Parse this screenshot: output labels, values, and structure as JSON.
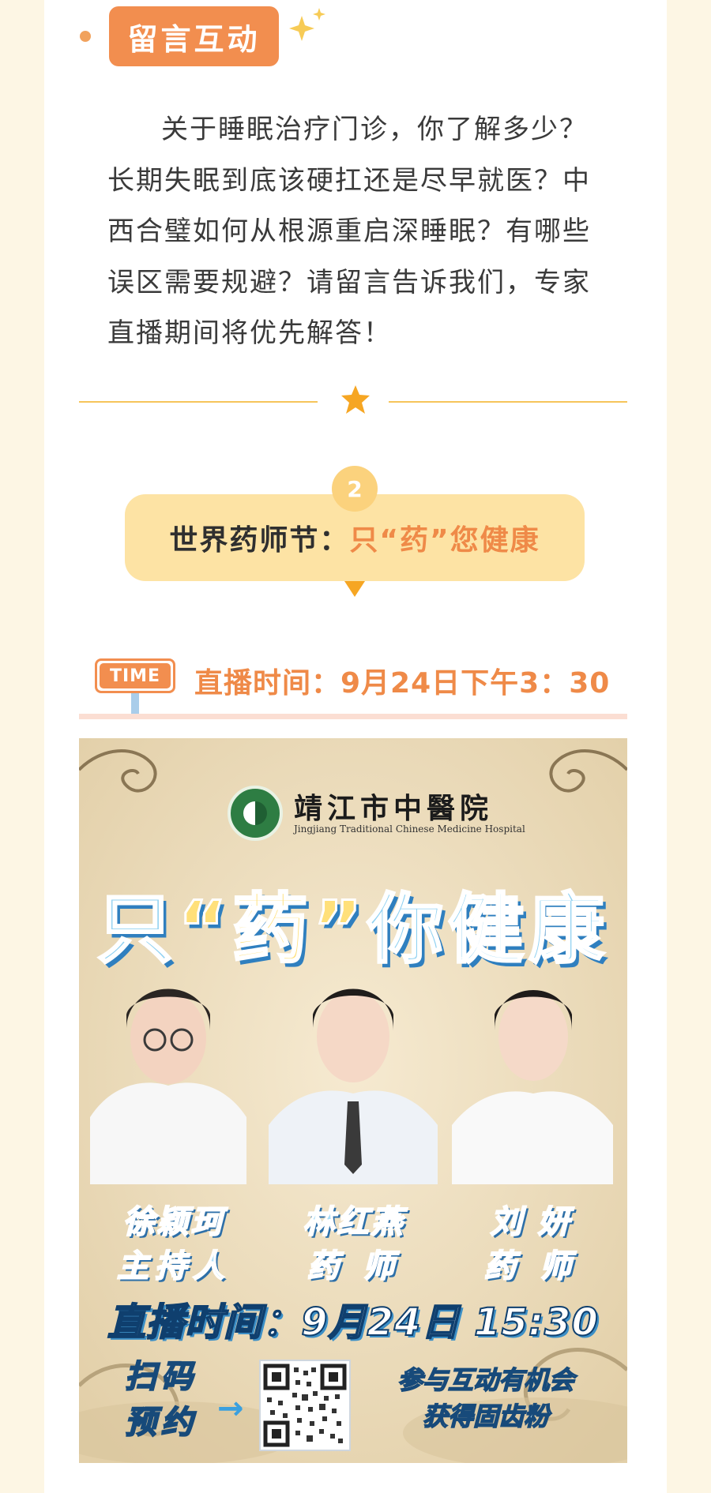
{
  "section": {
    "tag_label": "留言互动",
    "paragraph": "关于睡眠治疗门诊，你了解多少？长期失眠到底该硬扛还是尽早就医？中西合璧如何从根源重启深睡眠？有哪些误区需要规避？请留言告诉我们，专家直播期间将优先解答！"
  },
  "topic": {
    "number": "2",
    "title_prefix": "世界药师节：",
    "title_highlight": "只“药”您健康"
  },
  "broadcast": {
    "time_tag": "TIME",
    "time_text": "直播时间：9月24日下午3：30"
  },
  "poster": {
    "hospital_name": "靖江市中醫院",
    "hospital_name_en": "Jingjiang Traditional Chinese Medicine Hospital",
    "title_left": "只",
    "title_quoted": "“药”",
    "title_right": "你健康",
    "people": [
      {
        "name": "徐颖珂",
        "role": "主持人"
      },
      {
        "name": "林红燕",
        "role": "药 师"
      },
      {
        "name": "刘 妍",
        "role": "药 师"
      }
    ],
    "time_line": "直播时间：9月24日 15:30",
    "scan_line1": "扫码",
    "scan_line2": "预约",
    "arrow": "→",
    "promo_line1": "参与互动有机会",
    "promo_line2": "获得固齿粉"
  },
  "colors": {
    "accent_orange": "#f28e4f",
    "gold": "#f6c55a",
    "banner_bg": "#fde3a4",
    "page_bg": "#fdf6e4"
  }
}
